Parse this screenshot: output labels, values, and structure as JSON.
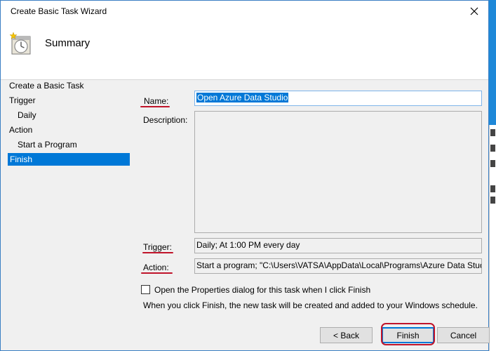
{
  "window": {
    "title": "Create Basic Task Wizard"
  },
  "header": {
    "title": "Summary"
  },
  "nav": {
    "items": [
      {
        "label": "Create a Basic Task"
      },
      {
        "label": "Trigger"
      },
      {
        "label": "Daily"
      },
      {
        "label": "Action"
      },
      {
        "label": "Start a Program"
      },
      {
        "label": "Finish"
      }
    ],
    "selected": "Finish"
  },
  "form": {
    "name_label": "Name:",
    "name_value": "Open Azure Data Studio",
    "description_label": "Description:",
    "description_value": "",
    "trigger_label": "Trigger:",
    "trigger_value": "Daily; At 1:00 PM every day",
    "action_label": "Action:",
    "action_value": "Start a program; \"C:\\Users\\VATSA\\AppData\\Local\\Programs\\Azure Data Stud"
  },
  "options": {
    "open_properties_label": "Open the Properties dialog for this task when I click Finish",
    "open_properties_checked": false,
    "info_text": "When you click Finish, the new task will be created and added to your Windows schedule."
  },
  "buttons": {
    "back": "< Back",
    "finish": "Finish",
    "cancel": "Cancel"
  },
  "colors": {
    "selection": "#0078d7",
    "annotation": "#c0142a",
    "desktop": "#1e88d8"
  },
  "icons": {
    "close": "close-icon",
    "header": "scheduled-task-clock-icon"
  }
}
